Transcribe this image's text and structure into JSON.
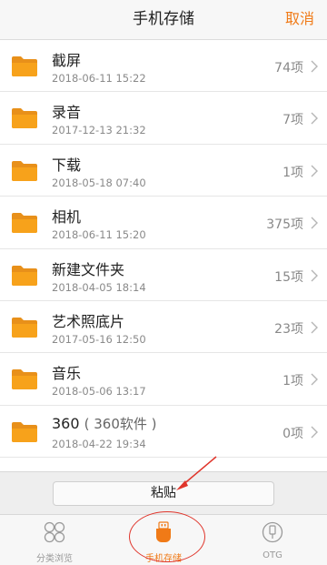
{
  "header": {
    "title": "手机存储",
    "cancel_label": "取消"
  },
  "folders": [
    {
      "name": "截屏",
      "sub": "",
      "date": "2018-06-11 15:22",
      "count": "74项"
    },
    {
      "name": "录音",
      "sub": "",
      "date": "2017-12-13 21:32",
      "count": "7项"
    },
    {
      "name": "下载",
      "sub": "",
      "date": "2018-05-18 07:40",
      "count": "1项"
    },
    {
      "name": "相机",
      "sub": "",
      "date": "2018-06-11 15:20",
      "count": "375项"
    },
    {
      "name": "新建文件夹",
      "sub": "",
      "date": "2018-04-05 18:14",
      "count": "15项"
    },
    {
      "name": "艺术照底片",
      "sub": "",
      "date": "2017-05-16 12:50",
      "count": "23项"
    },
    {
      "name": "音乐",
      "sub": "",
      "date": "2018-05-06 13:17",
      "count": "1项"
    },
    {
      "name": "360",
      "sub": "( 360软件 )",
      "date": "2018-04-22 19:34",
      "count": "0项"
    }
  ],
  "paste_bar": {
    "paste_label": "粘贴"
  },
  "tabbar": {
    "tabs": [
      {
        "label": "分类浏览",
        "icon": "category-grid-icon",
        "active": false
      },
      {
        "label": "手机存储",
        "icon": "phone-storage-icon",
        "active": true
      },
      {
        "label": "OTG",
        "icon": "otg-icon",
        "active": false
      }
    ]
  },
  "colors": {
    "accent": "#f07a17",
    "folder": "#f7a21b",
    "annotation": "#e0352b"
  }
}
